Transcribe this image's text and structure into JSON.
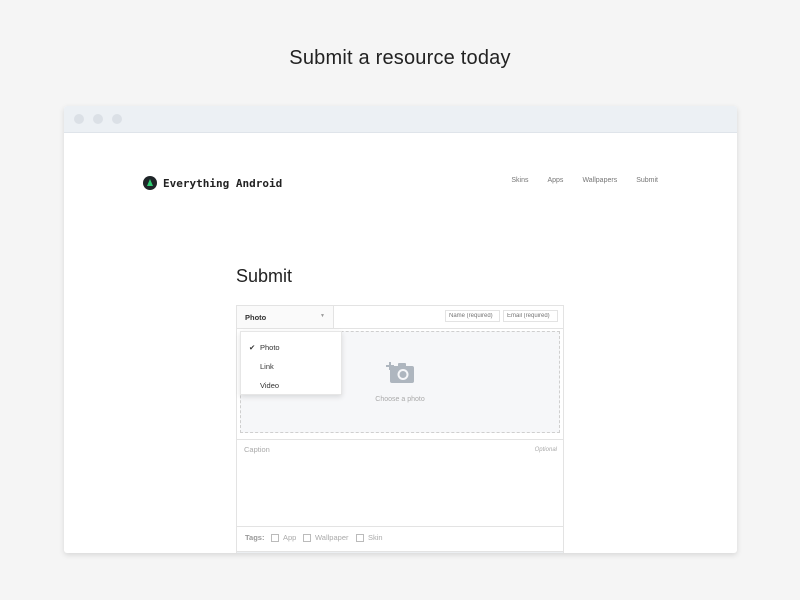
{
  "headline": "Submit a resource today",
  "brand": {
    "name": "Everything Android",
    "accent": "#2ecc71"
  },
  "nav": [
    {
      "label": "Skins"
    },
    {
      "label": "Apps"
    },
    {
      "label": "Wallpapers"
    },
    {
      "label": "Submit"
    }
  ],
  "page": {
    "title": "Submit"
  },
  "form": {
    "type_selected": "Photo",
    "name_placeholder": "Name (required)",
    "email_placeholder": "Email (required)",
    "dropzone_label": "Choose a photo",
    "caption_label": "Caption",
    "caption_hint": "Optional",
    "tags_label": "Tags:",
    "tags": [
      "App",
      "Wallpaper",
      "Skin"
    ]
  },
  "dropdown": {
    "options": [
      "Photo",
      "Link",
      "Video"
    ],
    "checked": "Photo"
  }
}
